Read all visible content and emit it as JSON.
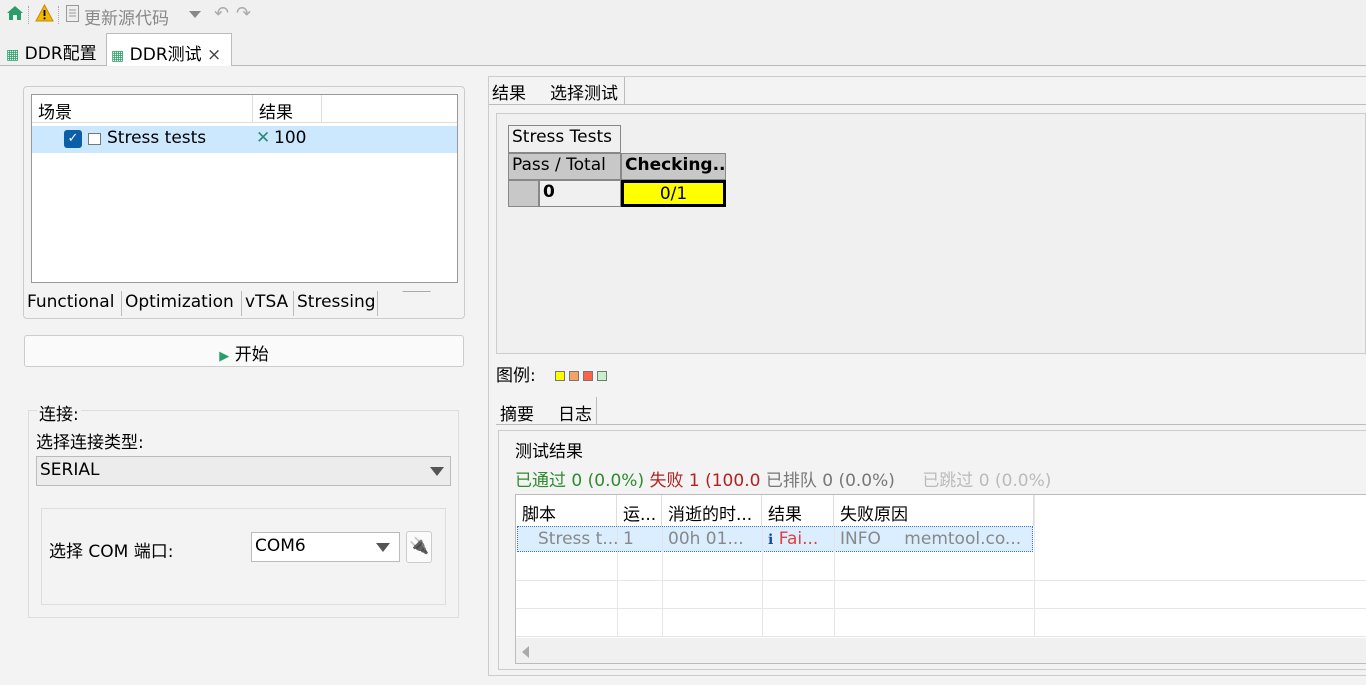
{
  "toolbar": {
    "update_source": "更新源代码"
  },
  "editor_tabs": [
    {
      "label": "DDR配置"
    },
    {
      "label": "DDR测试",
      "close": "×"
    }
  ],
  "scenario_table": {
    "headers": [
      "场景",
      "结果"
    ],
    "rows": [
      {
        "name": "Stress tests",
        "result_icon": "✕",
        "result": "100"
      }
    ]
  },
  "category_tabs": [
    "Functional",
    "Optimization",
    "vTSA",
    "Stressing"
  ],
  "start_button": "开始",
  "connection": {
    "group_label": "连接:",
    "type_label": "选择连接类型:",
    "type_value": "SERIAL",
    "port_label": "选择 COM 端口:",
    "port_value": "COM6"
  },
  "result_tabs": [
    "结果",
    "选择测试"
  ],
  "stress_grid": {
    "title": "Stress Tests",
    "pass_total_label": "Pass / Total",
    "checking": "Checking...",
    "row_value": "0",
    "cell_value": "0/1"
  },
  "legend": {
    "label": "图例:",
    "colors": [
      "#ffff00",
      "#f4a460",
      "#ff6347",
      "#c8f0c8"
    ]
  },
  "bottom_tabs": [
    "摘要",
    "日志"
  ],
  "summary": {
    "title": "测试结果",
    "passed": "已通过 0 (0.0%)",
    "failed": "失败 1 (100.0",
    "queued": "已排队 0 (0.0%)",
    "skipped": "已跳过 0 (0.0%)"
  },
  "results_grid": {
    "headers": [
      "脚本",
      "运...",
      "消逝的时...",
      "结果",
      "失败原因"
    ],
    "rows": [
      {
        "script": "Stress t...",
        "run": "1",
        "elapsed": "00h 01...",
        "result_icon": "ℹ",
        "result": "Fai...",
        "level": "INFO",
        "reason": "memtool.co..."
      }
    ]
  }
}
